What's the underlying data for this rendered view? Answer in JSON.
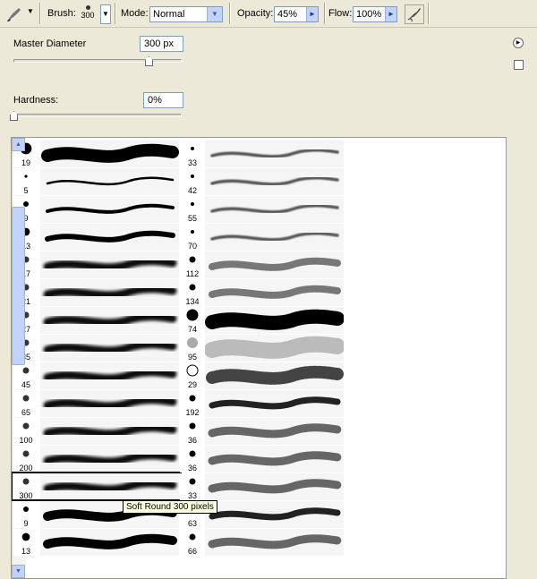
{
  "optbar": {
    "tool_icon": "brush-tool-icon",
    "brush_label": "Brush:",
    "brush_size": "300",
    "mode_label": "Mode:",
    "mode_value": "Normal",
    "opacity_label": "Opacity:",
    "opacity_value": "45%",
    "flow_label": "Flow:",
    "flow_value": "100%",
    "airbrush_icon": "airbrush-icon"
  },
  "master": {
    "diameter_label": "Master Diameter",
    "diameter_value": "300 px",
    "diameter_level": 0.75,
    "hardness_label": "Hardness:",
    "hardness_value": "0%",
    "hardness_level": 0.0
  },
  "brushes_left": [
    {
      "size": "19",
      "kind": "hard"
    },
    {
      "size": "5",
      "kind": "hard"
    },
    {
      "size": "9",
      "kind": "hard"
    },
    {
      "size": "13",
      "kind": "hard"
    },
    {
      "size": "17",
      "kind": "soft"
    },
    {
      "size": "21",
      "kind": "soft"
    },
    {
      "size": "27",
      "kind": "soft"
    },
    {
      "size": "35",
      "kind": "soft"
    },
    {
      "size": "45",
      "kind": "soft"
    },
    {
      "size": "65",
      "kind": "soft"
    },
    {
      "size": "100",
      "kind": "soft"
    },
    {
      "size": "200",
      "kind": "soft"
    },
    {
      "size": "300",
      "kind": "soft"
    },
    {
      "size": "9",
      "kind": "hard"
    },
    {
      "size": "13",
      "kind": "hard"
    }
  ],
  "brushes_right": [
    {
      "size": "33",
      "kind": "spray"
    },
    {
      "size": "42",
      "kind": "spray"
    },
    {
      "size": "55",
      "kind": "spray"
    },
    {
      "size": "70",
      "kind": "spray"
    },
    {
      "size": "112",
      "kind": "grass"
    },
    {
      "size": "134",
      "kind": "grass"
    },
    {
      "size": "74",
      "kind": "leaf"
    },
    {
      "size": "95",
      "kind": "dots"
    },
    {
      "size": "29",
      "kind": "star"
    },
    {
      "size": "192",
      "kind": "rough"
    },
    {
      "size": "36",
      "kind": "texture"
    },
    {
      "size": "36",
      "kind": "texture"
    },
    {
      "size": "33",
      "kind": "texture"
    },
    {
      "size": "63",
      "kind": "rough"
    },
    {
      "size": "66",
      "kind": "texture"
    }
  ],
  "tooltip": "Soft Round 300 pixels"
}
